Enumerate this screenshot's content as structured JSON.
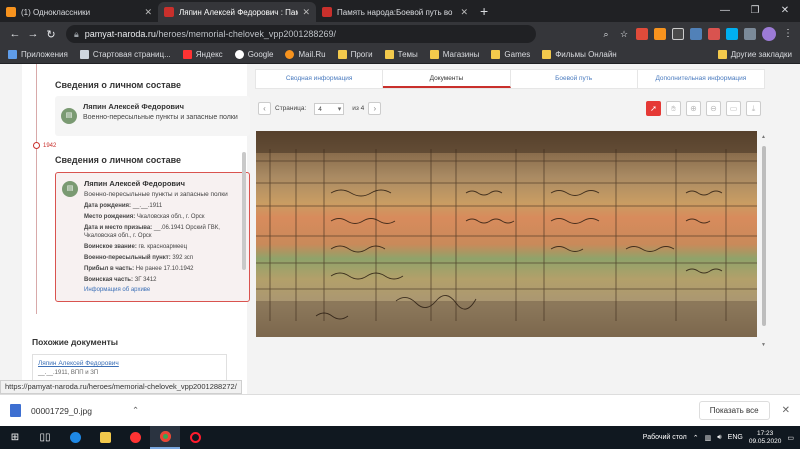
{
  "browser": {
    "tabs": [
      {
        "title": "(1) Одноклассники",
        "color": "#f7931e",
        "active": false
      },
      {
        "title": "Ляпин Алексей Федорович : Пам",
        "color": "#c9302c",
        "active": true
      },
      {
        "title": "Память народа:Боевой путь во",
        "color": "#c9302c",
        "active": false
      }
    ],
    "url_host": "pamyat-naroda.ru",
    "url_path": "/heroes/memorial-chelovek_vpp2001288269/",
    "bookmarks": [
      {
        "label": "Приложения",
        "kind": "apps"
      },
      {
        "label": "Стартовая страниц...",
        "kind": "page"
      },
      {
        "label": "Яндекс",
        "kind": "yandex"
      },
      {
        "label": "Google",
        "kind": "google"
      },
      {
        "label": "Mail.Ru",
        "kind": "mail"
      },
      {
        "label": "Проги",
        "kind": "folder"
      },
      {
        "label": "Темы",
        "kind": "folder"
      },
      {
        "label": "Магазины",
        "kind": "folder"
      },
      {
        "label": "Games",
        "kind": "folder"
      },
      {
        "label": "Фильмы Онлайн",
        "kind": "folder"
      }
    ],
    "bookmarks_other": "Другие закладки",
    "status_url": "https://pamyat-naroda.ru/heroes/memorial-chelovek_vpp2001288272/"
  },
  "left": {
    "heading1": "Сведения о личном составе",
    "card1": {
      "name": "Ляпин Алексей Федорович",
      "unit": "Военно-пересыльные пункты и запасные полки"
    },
    "year": "1942",
    "heading2": "Сведения о личном составе",
    "card2": {
      "name": "Ляпин Алексей Федорович",
      "unit": "Военно-пересыльные пункты и запасные полки",
      "rows": [
        {
          "k": "Дата рождения:",
          "v": "__.__.1911"
        },
        {
          "k": "Место рождения:",
          "v": "Чкаловская обл., г. Орск"
        },
        {
          "k": "Дата и место призыва:",
          "v": "__.06.1941 Орский ГВК, Чкаловская обл., г. Орск"
        },
        {
          "k": "Воинское звание:",
          "v": "гв. красноармеец"
        },
        {
          "k": "Военно-пересыльный пункт:",
          "v": "392 зсп"
        },
        {
          "k": "Прибыл в часть:",
          "v": "Не ранее 17.10.1942"
        },
        {
          "k": "Воинская часть:",
          "v": "ЗГ 3412"
        }
      ],
      "archive_link": "Информация об архиве"
    },
    "similar_heading": "Похожие документы",
    "similar": {
      "name": "Ляпин Алексей Федорович",
      "desc": "__.__.1911, ВПП и ЗП"
    }
  },
  "right": {
    "tabs": [
      "Сводная информация",
      "Документы",
      "Боевой путь",
      "Дополнительная информация"
    ],
    "active_tab": 1,
    "pager": {
      "label": "Страница:",
      "current": "4",
      "of": "из 4"
    }
  },
  "downloads": {
    "file": "00001729_0.jpg",
    "show_all": "Показать все"
  },
  "taskbar": {
    "desktop_label": "Рабочий стол",
    "lang": "ENG",
    "time": "17:23",
    "date": "09.05.2020"
  }
}
